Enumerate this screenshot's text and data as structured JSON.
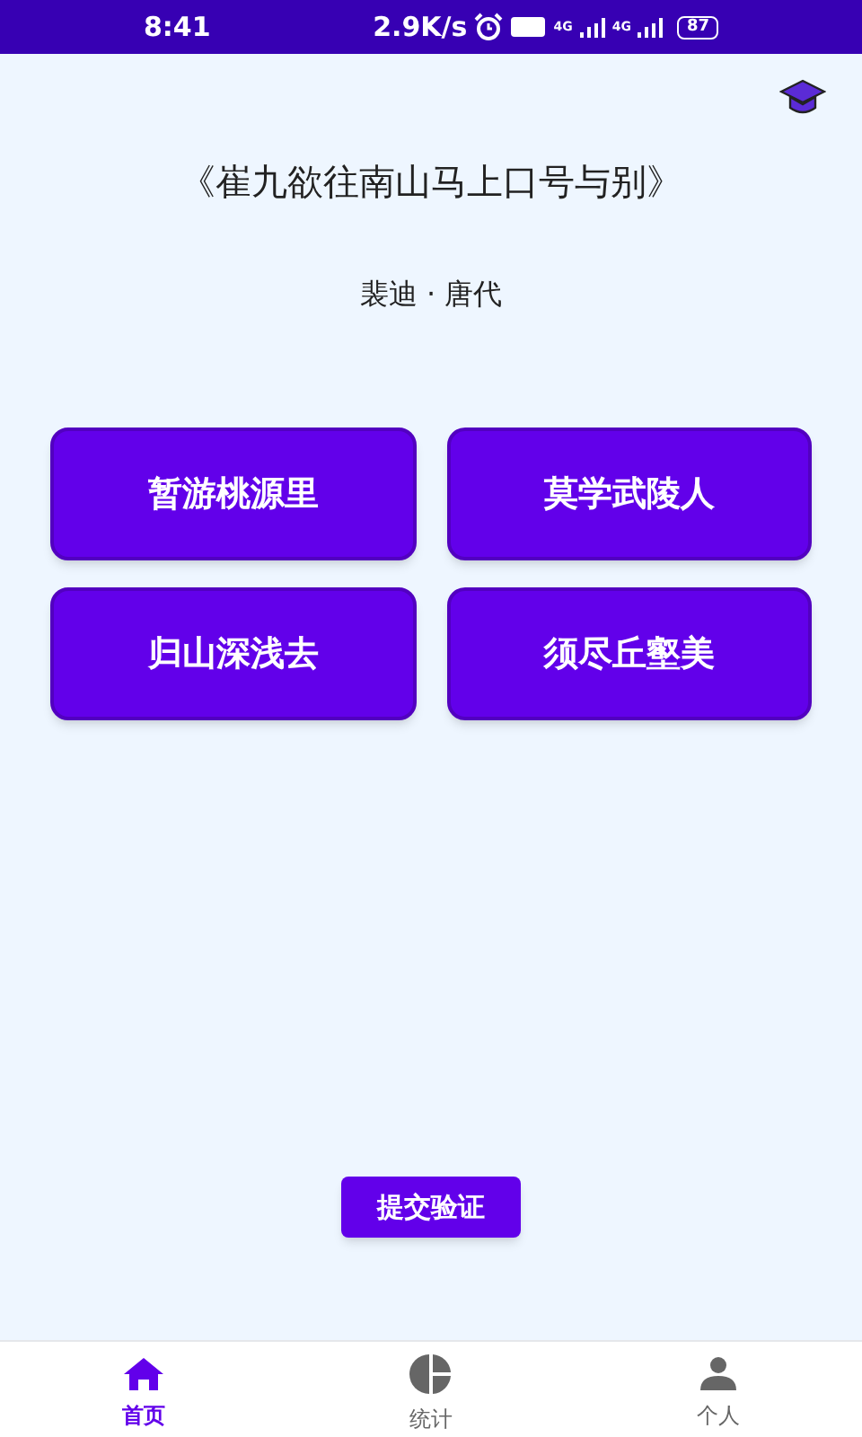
{
  "status_bar": {
    "time": "8:41",
    "speed": "2.9K/s",
    "network_1": "4G",
    "network_2": "4G",
    "battery": "87"
  },
  "poem": {
    "title": "《崔九欲往南山马上口号与别》",
    "author": "裴迪 · 唐代"
  },
  "options": [
    {
      "text": "暂游桃源里",
      "selected": false
    },
    {
      "text": "莫学武陵人",
      "selected": false
    },
    {
      "text": "归山深浅去",
      "selected": false
    },
    {
      "text": "须尽丘壑美",
      "selected": false
    }
  ],
  "submit": "提交验证",
  "nav": [
    {
      "label": "首页",
      "kind": "home",
      "selected": true
    },
    {
      "label": "统计",
      "kind": "stats",
      "selected": false
    },
    {
      "label": "个人",
      "kind": "profile",
      "selected": false
    }
  ]
}
